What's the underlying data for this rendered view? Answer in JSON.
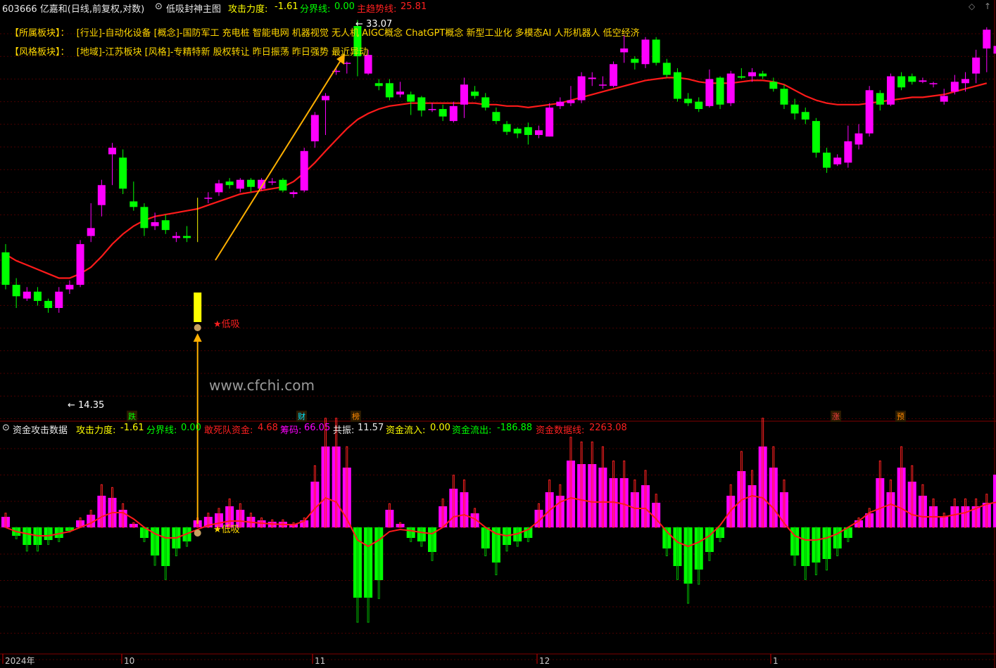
{
  "header": {
    "stock": "603666 亿嘉和(日线,前复权,对数)",
    "indicator_name": "低吸封神主图",
    "attack_label": "攻击力度:",
    "attack_value": "-1.61",
    "divider_label": "分界线:",
    "divider_value": "0.00",
    "trend_label": "主趋势线:",
    "trend_value": "25.81",
    "ctrl_restore": "◇",
    "ctrl_close": "↑"
  },
  "sectors": {
    "line1_label": "【所属板块】：",
    "line1_text": "[行业]-自动化设备 [概念]-国防军工 充电桩 智能电网 机器视觉 无人机 AIGC概念 ChatGPT概念 新型工业化 多模态AI 人形机器人 低空经济",
    "line2_label": "【风格板块】：",
    "line2_text": "[地域]-江苏板块 [风格]-专精特新 股权转让 昨日振荡 昨日强势 最近异动"
  },
  "annotations": {
    "high": "33.07",
    "low": "14.35",
    "buy_main": "★低吸",
    "buy_sub": "★低吸",
    "watermark": "www.cfchi.com"
  },
  "event_markers": [
    "跌",
    "财",
    "榜",
    "涨",
    "预"
  ],
  "sub_header": {
    "name": "资金攻击数据",
    "attack_label": "攻击力度:",
    "attack_value": "-1.61",
    "divider_label": "分界线:",
    "divider_value": "0.00",
    "dead_label": "敢死队资金:",
    "dead_value": "4.68",
    "chip_label": "筹码:",
    "chip_value": "66.05",
    "resonance_label": "共振:",
    "resonance_value": "11.57",
    "inflow_label": "资金流入:",
    "inflow_value": "0.00",
    "outflow_label": "资金流出:",
    "outflow_value": "-186.88",
    "dataline_label": "资金数据线:",
    "dataline_value": "2263.08"
  },
  "x_axis": [
    "2024年",
    "10",
    "11",
    "12",
    "1"
  ],
  "colors": {
    "up": "#ff00ff",
    "down": "#00ff00",
    "signal": "#ffff00",
    "ma": "#ff1a1a",
    "arrow": "#ffb000",
    "grid": "#4a0000"
  },
  "chart_data": {
    "type": "candlestick",
    "scale": "log",
    "ylim": [
      13.5,
      35.5
    ],
    "candles": [
      {
        "o": 20.1,
        "c": 18.6,
        "h": 20.5,
        "l": 18.4
      },
      {
        "o": 18.6,
        "c": 18.1,
        "h": 18.9,
        "l": 17.6
      },
      {
        "o": 18.0,
        "c": 18.3,
        "h": 18.5,
        "l": 17.9
      },
      {
        "o": 18.3,
        "c": 17.9,
        "h": 18.5,
        "l": 17.7
      },
      {
        "o": 17.9,
        "c": 17.6,
        "h": 18.0,
        "l": 17.4
      },
      {
        "o": 17.6,
        "c": 18.3,
        "h": 18.5,
        "l": 17.4
      },
      {
        "o": 18.4,
        "c": 18.6,
        "h": 18.8,
        "l": 18.2
      },
      {
        "o": 18.6,
        "c": 20.5,
        "h": 20.7,
        "l": 18.5
      },
      {
        "o": 20.9,
        "c": 21.3,
        "h": 22.6,
        "l": 20.6
      },
      {
        "o": 22.5,
        "c": 23.6,
        "h": 23.9,
        "l": 21.9
      },
      {
        "o": 25.4,
        "c": 25.8,
        "h": 26.1,
        "l": 23.6
      },
      {
        "o": 25.2,
        "c": 23.4,
        "h": 25.7,
        "l": 23.1
      },
      {
        "o": 22.7,
        "c": 22.4,
        "h": 23.8,
        "l": 22.2
      },
      {
        "o": 22.4,
        "c": 21.3,
        "h": 22.6,
        "l": 20.9
      },
      {
        "o": 21.4,
        "c": 21.6,
        "h": 22.1,
        "l": 21.2
      },
      {
        "o": 21.7,
        "c": 21.2,
        "h": 22.0,
        "l": 21.0
      },
      {
        "o": 20.8,
        "c": 20.9,
        "h": 21.1,
        "l": 20.6
      },
      {
        "o": 20.9,
        "c": 20.8,
        "h": 21.4,
        "l": 20.6
      },
      {
        "o": 20.7,
        "c": 22.6,
        "h": 22.9,
        "l": 20.6
      },
      {
        "o": 22.9,
        "c": 22.9,
        "h": 23.2,
        "l": 22.6
      },
      {
        "o": 23.2,
        "c": 23.7,
        "h": 23.9,
        "l": 23.0
      },
      {
        "o": 23.8,
        "c": 23.6,
        "h": 24.0,
        "l": 23.4
      },
      {
        "o": 23.4,
        "c": 23.9,
        "h": 24.0,
        "l": 23.2
      },
      {
        "o": 23.9,
        "c": 23.5,
        "h": 24.0,
        "l": 23.2
      },
      {
        "o": 23.4,
        "c": 23.9,
        "h": 24.0,
        "l": 23.3
      },
      {
        "o": 23.8,
        "c": 23.8,
        "h": 24.0,
        "l": 23.6
      },
      {
        "o": 23.9,
        "c": 23.3,
        "h": 24.0,
        "l": 23.2
      },
      {
        "o": 23.1,
        "c": 23.2,
        "h": 23.3,
        "l": 22.9
      },
      {
        "o": 23.3,
        "c": 25.6,
        "h": 25.8,
        "l": 23.2
      },
      {
        "o": 26.2,
        "c": 27.9,
        "h": 28.1,
        "l": 25.8
      },
      {
        "o": 28.9,
        "c": 29.2,
        "h": 29.4,
        "l": 26.6
      },
      {
        "o": 31.0,
        "c": 31.0,
        "h": 31.2,
        "l": 30.7
      },
      {
        "o": 31.6,
        "c": 31.6,
        "h": 31.7,
        "l": 30.8
      },
      {
        "o": 34.5,
        "c": 32.1,
        "h": 35.0,
        "l": 30.6
      },
      {
        "o": 30.8,
        "c": 32.2,
        "h": 32.6,
        "l": 30.7
      },
      {
        "o": 30.1,
        "c": 29.9,
        "h": 30.4,
        "l": 29.6
      },
      {
        "o": 30.1,
        "c": 29.1,
        "h": 30.4,
        "l": 28.9
      },
      {
        "o": 29.3,
        "c": 29.5,
        "h": 30.2,
        "l": 29.1
      },
      {
        "o": 29.3,
        "c": 28.8,
        "h": 29.5,
        "l": 27.9
      },
      {
        "o": 29.1,
        "c": 28.2,
        "h": 29.2,
        "l": 27.8
      },
      {
        "o": 28.3,
        "c": 28.3,
        "h": 28.7,
        "l": 28.1
      },
      {
        "o": 28.3,
        "c": 27.8,
        "h": 28.6,
        "l": 27.5
      },
      {
        "o": 27.5,
        "c": 28.5,
        "h": 28.8,
        "l": 27.4
      },
      {
        "o": 28.6,
        "c": 30.0,
        "h": 30.5,
        "l": 27.7
      },
      {
        "o": 29.5,
        "c": 29.2,
        "h": 29.9,
        "l": 29.0
      },
      {
        "o": 29.1,
        "c": 28.4,
        "h": 29.4,
        "l": 28.2
      },
      {
        "o": 28.1,
        "c": 27.5,
        "h": 28.4,
        "l": 27.3
      },
      {
        "o": 27.3,
        "c": 26.8,
        "h": 27.5,
        "l": 26.6
      },
      {
        "o": 27.0,
        "c": 26.7,
        "h": 27.1,
        "l": 26.4
      },
      {
        "o": 27.1,
        "c": 26.6,
        "h": 27.4,
        "l": 26.0
      },
      {
        "o": 26.6,
        "c": 26.9,
        "h": 27.2,
        "l": 26.4
      },
      {
        "o": 26.5,
        "c": 28.4,
        "h": 28.7,
        "l": 26.5
      },
      {
        "o": 28.5,
        "c": 28.8,
        "h": 29.1,
        "l": 28.3
      },
      {
        "o": 28.7,
        "c": 28.9,
        "h": 29.9,
        "l": 28.5
      },
      {
        "o": 28.9,
        "c": 30.6,
        "h": 30.9,
        "l": 28.7
      },
      {
        "o": 30.4,
        "c": 30.5,
        "h": 30.9,
        "l": 29.9
      },
      {
        "o": 30.0,
        "c": 30.0,
        "h": 30.6,
        "l": 29.7
      },
      {
        "o": 29.9,
        "c": 31.5,
        "h": 31.7,
        "l": 29.8
      },
      {
        "o": 32.4,
        "c": 32.7,
        "h": 33.8,
        "l": 31.6
      },
      {
        "o": 31.9,
        "c": 31.6,
        "h": 32.1,
        "l": 31.1
      },
      {
        "o": 31.5,
        "c": 33.4,
        "h": 33.6,
        "l": 31.2
      },
      {
        "o": 33.4,
        "c": 31.6,
        "h": 33.6,
        "l": 31.4
      },
      {
        "o": 31.6,
        "c": 30.7,
        "h": 31.9,
        "l": 30.5
      },
      {
        "o": 30.9,
        "c": 29.0,
        "h": 31.2,
        "l": 28.8
      },
      {
        "o": 29.0,
        "c": 28.7,
        "h": 29.4,
        "l": 28.5
      },
      {
        "o": 28.8,
        "c": 28.3,
        "h": 29.1,
        "l": 28.1
      },
      {
        "o": 28.5,
        "c": 30.4,
        "h": 31.1,
        "l": 28.4
      },
      {
        "o": 30.5,
        "c": 28.6,
        "h": 30.6,
        "l": 28.3
      },
      {
        "o": 28.7,
        "c": 30.8,
        "h": 31.0,
        "l": 28.5
      },
      {
        "o": 30.6,
        "c": 30.5,
        "h": 31.2,
        "l": 30.4
      },
      {
        "o": 30.6,
        "c": 30.9,
        "h": 31.2,
        "l": 30.2
      },
      {
        "o": 30.8,
        "c": 30.6,
        "h": 31.0,
        "l": 30.4
      },
      {
        "o": 30.2,
        "c": 29.7,
        "h": 30.5,
        "l": 29.5
      },
      {
        "o": 29.7,
        "c": 28.6,
        "h": 30.0,
        "l": 28.3
      },
      {
        "o": 28.6,
        "c": 28.0,
        "h": 29.0,
        "l": 27.6
      },
      {
        "o": 28.1,
        "c": 27.6,
        "h": 28.4,
        "l": 27.3
      },
      {
        "o": 27.5,
        "c": 25.5,
        "h": 27.7,
        "l": 25.2
      },
      {
        "o": 25.5,
        "c": 24.6,
        "h": 25.8,
        "l": 24.3
      },
      {
        "o": 24.8,
        "c": 25.2,
        "h": 25.4,
        "l": 24.7
      },
      {
        "o": 24.9,
        "c": 26.2,
        "h": 27.2,
        "l": 24.6
      },
      {
        "o": 26.0,
        "c": 26.7,
        "h": 27.3,
        "l": 25.7
      },
      {
        "o": 26.7,
        "c": 29.6,
        "h": 29.9,
        "l": 26.5
      },
      {
        "o": 29.4,
        "c": 28.6,
        "h": 29.6,
        "l": 28.2
      },
      {
        "o": 28.6,
        "c": 30.6,
        "h": 30.8,
        "l": 28.5
      },
      {
        "o": 30.6,
        "c": 29.8,
        "h": 30.9,
        "l": 29.6
      },
      {
        "o": 30.6,
        "c": 30.2,
        "h": 30.8,
        "l": 30.0
      },
      {
        "o": 30.2,
        "c": 30.3,
        "h": 30.5,
        "l": 30.1
      },
      {
        "o": 30.1,
        "c": 30.1,
        "h": 30.2,
        "l": 29.8
      },
      {
        "o": 28.8,
        "c": 29.2,
        "h": 29.7,
        "l": 28.6
      },
      {
        "o": 29.5,
        "c": 30.2,
        "h": 30.7,
        "l": 29.3
      },
      {
        "o": 30.1,
        "c": 30.4,
        "h": 30.9,
        "l": 29.5
      },
      {
        "o": 30.8,
        "c": 32.0,
        "h": 32.6,
        "l": 30.1
      },
      {
        "o": 32.7,
        "c": 34.2,
        "h": 34.4,
        "l": 30.9
      },
      {
        "o": 32.3,
        "c": 32.9,
        "h": 34.2,
        "l": 32.1
      }
    ],
    "ma": [
      20.0,
      19.7,
      19.5,
      19.3,
      19.1,
      18.9,
      18.9,
      19.1,
      19.4,
      19.9,
      20.5,
      21.0,
      21.4,
      21.7,
      21.9,
      22.0,
      22.1,
      22.2,
      22.3,
      22.5,
      22.7,
      22.9,
      23.1,
      23.2,
      23.3,
      23.4,
      23.5,
      23.8,
      24.3,
      24.9,
      25.6,
      26.3,
      27.0,
      27.6,
      28.0,
      28.3,
      28.5,
      28.6,
      28.7,
      28.7,
      28.7,
      28.7,
      28.7,
      28.7,
      28.7,
      28.6,
      28.6,
      28.5,
      28.5,
      28.4,
      28.5,
      28.6,
      28.7,
      28.9,
      29.1,
      29.3,
      29.5,
      29.7,
      29.9,
      30.1,
      30.3,
      30.4,
      30.5,
      30.5,
      30.4,
      30.2,
      30.1,
      30.1,
      30.1,
      30.2,
      30.3,
      30.3,
      30.2,
      30.0,
      29.6,
      29.2,
      28.9,
      28.7,
      28.6,
      28.6,
      28.6,
      28.7,
      28.8,
      28.9,
      29.0,
      29.1,
      29.1,
      29.2,
      29.3,
      29.5,
      29.7,
      29.9,
      30.1
    ],
    "signal_index": 18,
    "sub_bars": [
      0.15,
      -0.12,
      -0.25,
      -0.25,
      -0.18,
      -0.15,
      -0.05,
      0.1,
      0.18,
      0.45,
      0.42,
      0.25,
      0.05,
      -0.15,
      -0.4,
      -0.55,
      -0.3,
      -0.2,
      0.1,
      0.15,
      0.2,
      0.3,
      0.25,
      0.15,
      0.1,
      0.08,
      0.08,
      0.05,
      0.1,
      0.65,
      1.15,
      1.15,
      0.85,
      -1.0,
      -1.0,
      -0.75,
      0.25,
      0.05,
      -0.15,
      -0.2,
      -0.35,
      0.3,
      0.55,
      0.5,
      0.2,
      -0.3,
      -0.5,
      -0.25,
      -0.2,
      -0.15,
      0.25,
      0.5,
      0.45,
      0.95,
      0.9,
      0.9,
      0.85,
      0.7,
      0.7,
      0.5,
      0.6,
      0.35,
      -0.3,
      -0.55,
      -0.8,
      -0.6,
      -0.35,
      -0.15,
      0.45,
      0.8,
      0.6,
      1.15,
      0.85,
      0.5,
      -0.4,
      -0.55,
      -0.5,
      -0.45,
      -0.3,
      -0.15,
      0.1,
      0.2,
      0.7,
      0.5,
      0.85,
      0.65,
      0.45,
      0.3,
      0.15,
      0.3,
      0.3,
      0.3,
      0.35,
      0.75,
      0.7
    ],
    "sub_line": [
      0.0,
      -0.1,
      -0.15,
      -0.2,
      -0.2,
      -0.15,
      -0.1,
      0.0,
      0.1,
      0.25,
      0.35,
      0.35,
      0.2,
      0.0,
      -0.15,
      -0.25,
      -0.25,
      -0.15,
      -0.05,
      0.05,
      0.1,
      0.15,
      0.15,
      0.12,
      0.1,
      0.08,
      0.07,
      0.06,
      0.15,
      0.45,
      0.7,
      0.6,
      0.2,
      -0.3,
      -0.45,
      -0.3,
      -0.1,
      -0.05,
      -0.08,
      -0.12,
      -0.15,
      0.0,
      0.25,
      0.3,
      0.2,
      0.0,
      -0.15,
      -0.2,
      -0.15,
      -0.05,
      0.15,
      0.4,
      0.6,
      0.7,
      0.65,
      0.6,
      0.6,
      0.6,
      0.55,
      0.45,
      0.45,
      0.2,
      -0.1,
      -0.35,
      -0.45,
      -0.35,
      -0.2,
      0.05,
      0.4,
      0.65,
      0.75,
      0.7,
      0.45,
      0.1,
      -0.2,
      -0.3,
      -0.3,
      -0.25,
      -0.15,
      0.0,
      0.15,
      0.35,
      0.45,
      0.55,
      0.45,
      0.3,
      0.25,
      0.25,
      0.25,
      0.3,
      0.35,
      0.45,
      0.55,
      0.6
    ]
  }
}
